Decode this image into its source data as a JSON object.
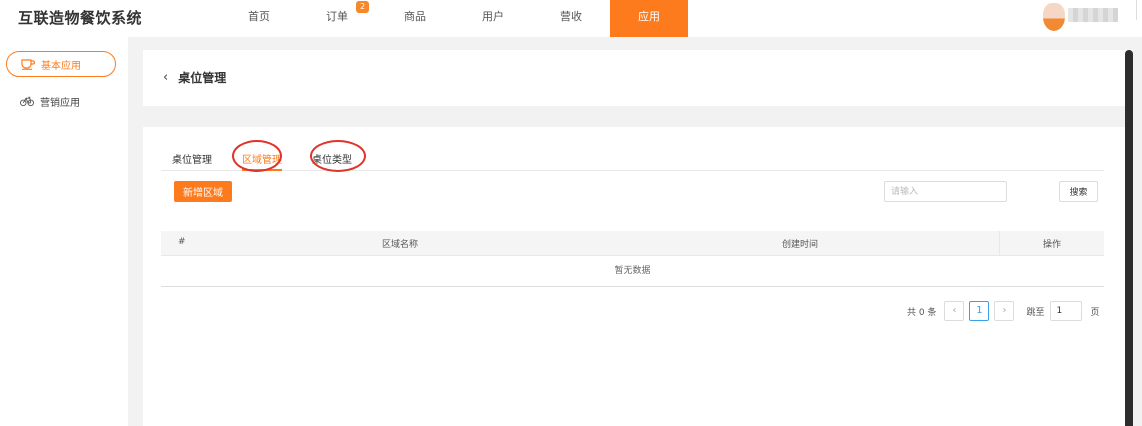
{
  "app": {
    "title": "互联造物餐饮系统"
  },
  "nav": {
    "items": [
      {
        "label": "首页"
      },
      {
        "label": "订单",
        "badge": "2"
      },
      {
        "label": "商品"
      },
      {
        "label": "用户"
      },
      {
        "label": "营收"
      },
      {
        "label": "应用",
        "active": true
      }
    ]
  },
  "sidebar": {
    "items": [
      {
        "label": "基本应用",
        "icon": "cup-icon",
        "active": true
      },
      {
        "label": "营销应用",
        "icon": "bicycle-icon"
      }
    ]
  },
  "header": {
    "back_icon": "‹",
    "title": "桌位管理"
  },
  "tabs": [
    {
      "label": "桌位管理"
    },
    {
      "label": "区域管理",
      "active": true
    },
    {
      "label": "桌位类型"
    }
  ],
  "toolbar": {
    "add_label": "新增区域",
    "search_placeholder": "请输入",
    "search_label": "搜索"
  },
  "table": {
    "columns": [
      "#",
      "区域名称",
      "创建时间",
      "操作"
    ],
    "empty_text": "暂无数据"
  },
  "pagination": {
    "total_text": "共 0 条",
    "prev": "‹",
    "current_page": "1",
    "next": "›",
    "jump_label": "跳至",
    "jump_value": "1",
    "page_suffix": "页"
  },
  "colors": {
    "accent": "#fd7b1c",
    "annotation": "#e0332a",
    "pager_active": "#3aa0e8"
  }
}
